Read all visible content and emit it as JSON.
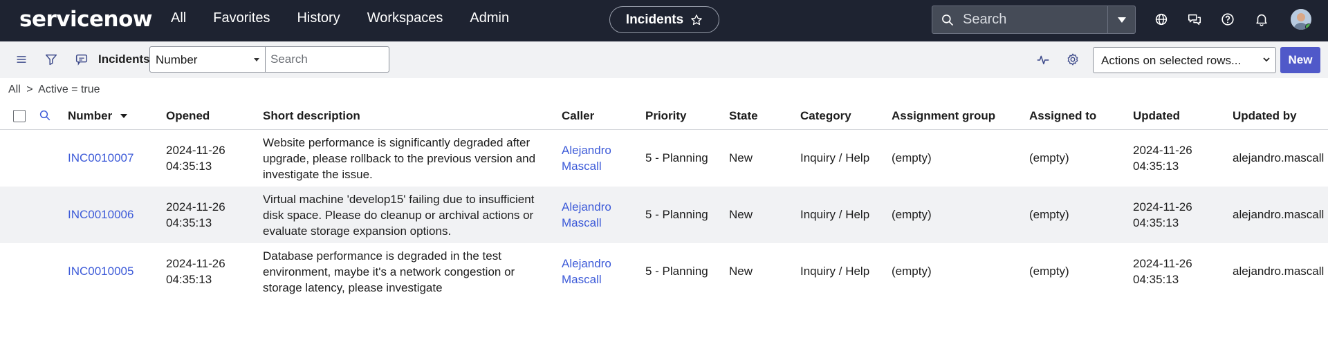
{
  "topnav": {
    "logo": "servicenow",
    "links": [
      "All",
      "Favorites",
      "History",
      "Workspaces",
      "Admin"
    ],
    "context_pill": "Incidents",
    "search_placeholder": "Search"
  },
  "toolbar": {
    "title": "Incidents",
    "search_field": "Number",
    "search_placeholder": "Search",
    "actions_label": "Actions on selected rows...",
    "new_label": "New"
  },
  "breadcrumb": {
    "all": "All",
    "sep": ">",
    "filter": "Active = true"
  },
  "table": {
    "columns": [
      "Number",
      "Opened",
      "Short description",
      "Caller",
      "Priority",
      "State",
      "Category",
      "Assignment group",
      "Assigned to",
      "Updated",
      "Updated by"
    ],
    "rows": [
      {
        "number": "INC0010007",
        "opened_date": "2024-11-26",
        "opened_time": "04:35:13",
        "desc": [
          "Website performance is significantly degraded after",
          "upgrade, please rollback to the previous version and",
          "investigate the issue."
        ],
        "caller_first": "Alejandro",
        "caller_last": "Mascall",
        "priority": "5 - Planning",
        "state": "New",
        "category": "Inquiry / Help",
        "assignment_group": "(empty)",
        "assigned_to": "(empty)",
        "updated_date": "2024-11-26",
        "updated_time": "04:35:13",
        "updated_by": "alejandro.mascall"
      },
      {
        "number": "INC0010006",
        "opened_date": "2024-11-26",
        "opened_time": "04:35:13",
        "desc": [
          "Virtual machine 'develop15' failing due to insufficient",
          "disk space. Please do cleanup or archival actions or",
          "evaluate storage expansion options."
        ],
        "caller_first": "Alejandro",
        "caller_last": "Mascall",
        "priority": "5 - Planning",
        "state": "New",
        "category": "Inquiry / Help",
        "assignment_group": "(empty)",
        "assigned_to": "(empty)",
        "updated_date": "2024-11-26",
        "updated_time": "04:35:13",
        "updated_by": "alejandro.mascall"
      },
      {
        "number": "INC0010005",
        "opened_date": "2024-11-26",
        "opened_time": "04:35:13",
        "desc": [
          "Database performance is degraded in the test",
          "environment, maybe it's a network congestion or",
          "storage latency, please investigate"
        ],
        "caller_first": "Alejandro",
        "caller_last": "Mascall",
        "priority": "5 - Planning",
        "state": "New",
        "category": "Inquiry / Help",
        "assignment_group": "(empty)",
        "assigned_to": "(empty)",
        "updated_date": "2024-11-26",
        "updated_time": "04:35:13",
        "updated_by": "alejandro.mascall"
      }
    ]
  }
}
